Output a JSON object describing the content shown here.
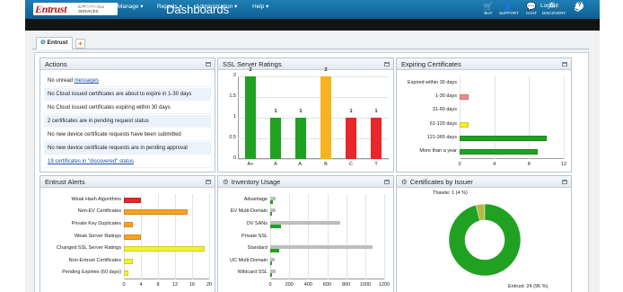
{
  "header": {
    "brand": "Entrust",
    "brand_sub": "CERTIFICATE SERVICES",
    "title": "Dashboards",
    "icons": [
      {
        "label": "BUY",
        "glyph": "🛒",
        "name": "cart-icon"
      },
      {
        "label": "SUPPORT",
        "glyph": "👤",
        "name": "support-icon"
      },
      {
        "label": "CHAT",
        "glyph": "💬",
        "name": "chat-icon"
      },
      {
        "label": "DISCOVERY",
        "glyph": "🔍",
        "name": "discovery-icon"
      }
    ],
    "gear": "⚙"
  },
  "menu": {
    "items": [
      "Dashboards",
      "Create ▾",
      "Manage ▾",
      "Reports ▾",
      "Administration ▾",
      "Help ▾"
    ],
    "logout": "Logout",
    "help_icon": "?"
  },
  "tabs": {
    "active": "Entrust",
    "add": "+"
  },
  "actions": {
    "title": "Actions",
    "rows": [
      {
        "prefix": "No unread ",
        "link": "messages"
      },
      {
        "text": "No Cloud issued certificates are about to expire in 1-30 days"
      },
      {
        "text": "No Cloud issued certificates expiring within 30 days"
      },
      {
        "text": "2 certificates are in pending request status"
      },
      {
        "text": "No new device certificate requests have been submitted"
      },
      {
        "text": "No new device certificate requests are in pending approval"
      },
      {
        "link": "19 certificates in \"discovered\" status"
      }
    ]
  },
  "ssl_ratings": {
    "title": "SSL Server Ratings"
  },
  "expiring": {
    "title": "Expiring Certificates"
  },
  "alerts": {
    "title": "Entrust Alerts"
  },
  "inventory": {
    "title": "Inventory Usage"
  },
  "issuer": {
    "title": "Certificates by Issuer"
  },
  "chart_data": [
    {
      "type": "bar",
      "panel": "ssl_ratings",
      "categories": [
        "A+",
        "A",
        "A-",
        "B",
        "C",
        "T"
      ],
      "values": [
        2,
        1,
        1,
        2,
        1,
        1
      ],
      "colors": [
        "#21a121",
        "#21a121",
        "#21a121",
        "#f6b321",
        "#e8262c",
        "#e8262c"
      ],
      "ylim": [
        0,
        2
      ],
      "yticks": [
        0,
        0.5,
        1,
        1.5,
        2
      ]
    },
    {
      "type": "bar",
      "orientation": "horizontal",
      "panel": "expiring",
      "categories": [
        "Expired within 30 days",
        "1-30 days",
        "31-60 days",
        "61-120 days",
        "121-365 days",
        "More than a year"
      ],
      "values": [
        0,
        1,
        0,
        1,
        10,
        9
      ],
      "colors": [
        "#21a121",
        "#f08a8a",
        "#21a121",
        "#f2f22a",
        "#21a121",
        "#21a121"
      ],
      "xlim": [
        0,
        12
      ],
      "xticks": [
        0,
        4,
        8,
        12
      ]
    },
    {
      "type": "bar",
      "orientation": "horizontal",
      "panel": "alerts",
      "categories": [
        "Weak Hash Algorithms",
        "Non-EV Certificates",
        "Private Key Duplicates",
        "Weak Server Ratings",
        "Changed SSL Server Ratings",
        "Non-Entrust Certificates",
        "Pending Expiries (60 days)"
      ],
      "values": [
        4,
        15,
        2,
        4,
        19,
        2,
        1
      ],
      "colors": [
        "#e8262c",
        "#f6a321",
        "#f6a321",
        "#f6a321",
        "#f2f22a",
        "#f2f22a",
        "#f2f22a"
      ],
      "xlim": [
        0,
        20
      ],
      "xticks": [
        0,
        4,
        8,
        12,
        16,
        20
      ]
    },
    {
      "type": "bar",
      "orientation": "horizontal",
      "panel": "inventory",
      "categories": [
        "Advantage",
        "EV Multi-Domain",
        "OV SANs",
        "Private SSL",
        "Standard",
        "UC Multi-Domain",
        "Wildcard SSL"
      ],
      "series": [
        {
          "values": [
            60,
            60,
            740,
            0,
            1080,
            50,
            60
          ],
          "color": "#bdbdbd"
        },
        {
          "values": [
            30,
            20,
            110,
            0,
            90,
            20,
            20
          ],
          "color": "#21a121"
        }
      ],
      "xlim": [
        0,
        1200
      ],
      "xticks": [
        0,
        200,
        400,
        600,
        800,
        1000,
        1200
      ]
    },
    {
      "type": "pie",
      "panel": "issuer",
      "categories": [
        "Entrust",
        "Thawte"
      ],
      "values": [
        24,
        1
      ],
      "percent_labels": [
        "Entrust: 24 (96 %)",
        "Thawte: 1 (4 %)"
      ],
      "colors": [
        "#21a121",
        "#b8b845"
      ]
    }
  ]
}
